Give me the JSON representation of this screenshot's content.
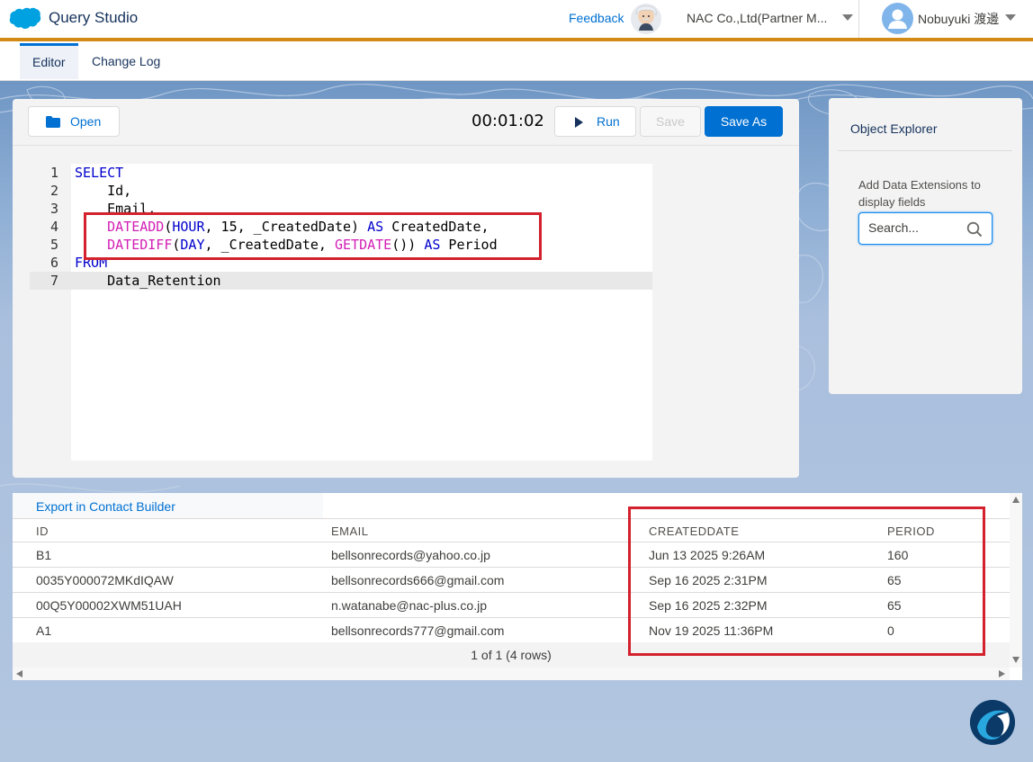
{
  "header": {
    "app_title": "Query Studio",
    "feedback_label": "Feedback",
    "org_label": "NAC Co.,Ltd(Partner M...",
    "user_name": "Nobuyuki 渡邊"
  },
  "tabs": [
    {
      "label": "Editor",
      "active": true
    },
    {
      "label": "Change Log",
      "active": false
    }
  ],
  "toolbar": {
    "open_label": "Open",
    "timer": "00:01:02",
    "run_label": "Run",
    "save_label": "Save",
    "save_as_label": "Save As"
  },
  "editor": {
    "lines": [
      {
        "n": "1",
        "tokens": [
          {
            "t": "SELECT",
            "c": "kw"
          }
        ]
      },
      {
        "n": "2",
        "tokens": [
          {
            "t": "    Id,",
            "c": "plain"
          }
        ]
      },
      {
        "n": "3",
        "tokens": [
          {
            "t": "    Email,",
            "c": "plain"
          }
        ]
      },
      {
        "n": "4",
        "tokens": [
          {
            "t": "    ",
            "c": "plain"
          },
          {
            "t": "DATEADD",
            "c": "fn"
          },
          {
            "t": "(",
            "c": "plain"
          },
          {
            "t": "HOUR",
            "c": "kw"
          },
          {
            "t": ", 15, _CreatedDate) ",
            "c": "plain"
          },
          {
            "t": "AS",
            "c": "kw"
          },
          {
            "t": " CreatedDate,",
            "c": "plain"
          }
        ]
      },
      {
        "n": "5",
        "tokens": [
          {
            "t": "    ",
            "c": "plain"
          },
          {
            "t": "DATEDIFF",
            "c": "fn"
          },
          {
            "t": "(",
            "c": "plain"
          },
          {
            "t": "DAY",
            "c": "kw"
          },
          {
            "t": ", _CreatedDate, ",
            "c": "plain"
          },
          {
            "t": "GETDATE",
            "c": "fn"
          },
          {
            "t": "()) ",
            "c": "plain"
          },
          {
            "t": "AS",
            "c": "kw"
          },
          {
            "t": " Period",
            "c": "plain"
          }
        ]
      },
      {
        "n": "6",
        "tokens": [
          {
            "t": "FROM",
            "c": "kw"
          }
        ]
      },
      {
        "n": "7",
        "tokens": [
          {
            "t": "    Data_Retention",
            "c": "plain"
          }
        ]
      }
    ],
    "active_line": "7"
  },
  "explorer": {
    "title": "Object Explorer",
    "hint": "Add Data Extensions to display fields",
    "search_placeholder": "Search..."
  },
  "results": {
    "export_label": "Export in Contact Builder",
    "columns": [
      "ID",
      "EMAIL",
      "CREATEDDATE",
      "PERIOD"
    ],
    "rows": [
      [
        "B1",
        "bellsonrecords@yahoo.co.jp",
        "Jun 13 2025 9:26AM",
        "160"
      ],
      [
        "0035Y000072MKdIQAW",
        "bellsonrecords666@gmail.com",
        "Sep 16 2025 2:31PM",
        "65"
      ],
      [
        "00Q5Y00002XWM51UAH",
        "n.watanabe@nac-plus.co.jp",
        "Sep 16 2025 2:32PM",
        "65"
      ],
      [
        "A1",
        "bellsonrecords777@gmail.com",
        "Nov 19 2025 11:36PM",
        "0"
      ]
    ],
    "pagination": "1 of 1 (4 rows)"
  },
  "colors": {
    "brand_blue": "#0070d2",
    "accent_orange": "#d28a15",
    "highlight_red": "#d3212d"
  }
}
